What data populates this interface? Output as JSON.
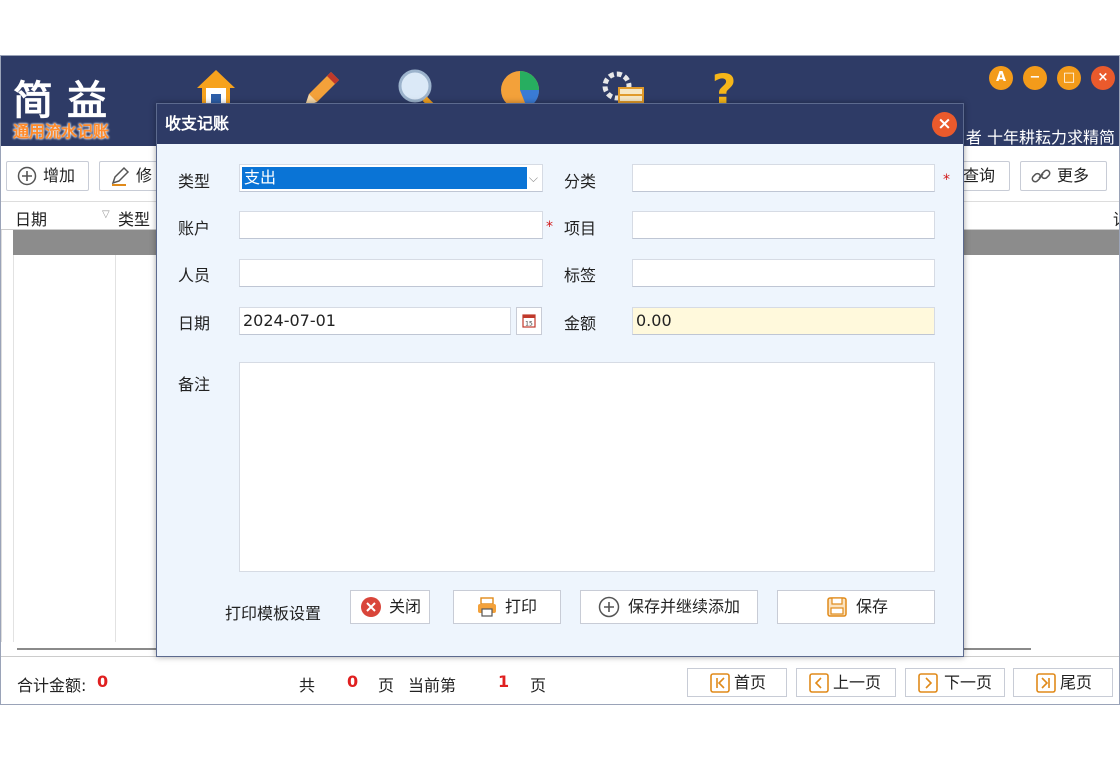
{
  "app": {
    "logo_title": "简益",
    "logo_subtitle": "通用流水记账",
    "tagline_prefix": "者",
    "tagline": "十年耕耘力求精简",
    "nav_icons": [
      "home-icon",
      "edit-icon",
      "search-icon",
      "chart-icon",
      "settings-icon",
      "help-icon"
    ],
    "window_buttons": {
      "font": "A",
      "minimize": "−",
      "maximize": "□",
      "close": "×"
    },
    "colors": {
      "header_bg": "#2e3b66",
      "accent_orange": "#f39b1a",
      "close_red": "#ea5a2c",
      "dialog_bg": "#eef5fd",
      "selection_blue": "#0a74d6",
      "required_red": "#d01818"
    }
  },
  "toolbar": {
    "add": "增加",
    "edit": "修",
    "query": "查询",
    "more": "更多"
  },
  "grid": {
    "columns": [
      "日期",
      "类型"
    ],
    "right_partial": "详"
  },
  "footer": {
    "total_label": "合计金额:",
    "total_value": "0",
    "pages_prefix": "共",
    "pages_total": "0",
    "pages_unit": "页",
    "current_prefix": "当前第",
    "current_page": "1",
    "current_unit": "页",
    "first": "首页",
    "prev": "上一页",
    "next": "下一页",
    "last": "尾页"
  },
  "dialog": {
    "title": "收支记账",
    "type_label": "类型",
    "type_value": "支出",
    "category_label": "分类",
    "category_value": "",
    "account_label": "账户",
    "account_value": "",
    "project_label": "项目",
    "project_value": "",
    "person_label": "人员",
    "person_value": "",
    "tag_label": "标签",
    "tag_value": "",
    "date_label": "日期",
    "date_value": "2024-07-01",
    "amount_label": "金额",
    "amount_value": "0.00",
    "memo_label": "备注",
    "memo_value": "",
    "required_mark": "*",
    "print_template": "打印模板设置",
    "close_btn": "关闭",
    "print_btn": "打印",
    "save_continue_btn": "保存并继续添加",
    "save_btn": "保存"
  }
}
